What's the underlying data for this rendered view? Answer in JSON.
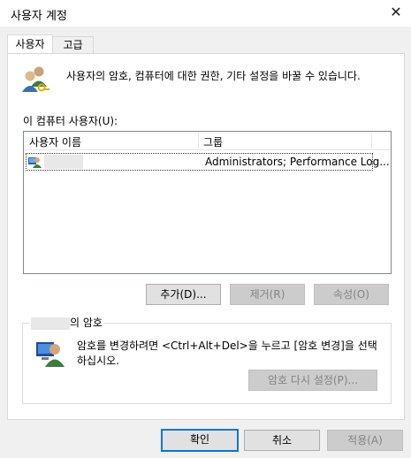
{
  "window": {
    "title": "사용자 계정"
  },
  "tabs": [
    {
      "label": "사용자"
    },
    {
      "label": "고급"
    }
  ],
  "intro": {
    "text": "사용자의 암호, 컴퓨터에 대한 권한, 기타 설정을 바꿀 수 있습니다."
  },
  "users_section": {
    "label": "이 컴퓨터 사용자(U):"
  },
  "user_list": {
    "columns": [
      "사용자 이름",
      "그룹"
    ],
    "rows": [
      {
        "group": "Administrators; Performance Log..."
      }
    ]
  },
  "list_buttons": {
    "add": "추가(D)...",
    "remove": "제거(R)",
    "properties": "속성(O)"
  },
  "password_group": {
    "title_suffix": "의 암호",
    "text": "암호를 변경하려면 <Ctrl+Alt+Del>을 누르고 [암호 변경]을 선택하십시오.",
    "reset_button": "암호 다시 설정(P)..."
  },
  "footer_buttons": {
    "ok": "확인",
    "cancel": "취소",
    "apply": "적용(A)"
  }
}
